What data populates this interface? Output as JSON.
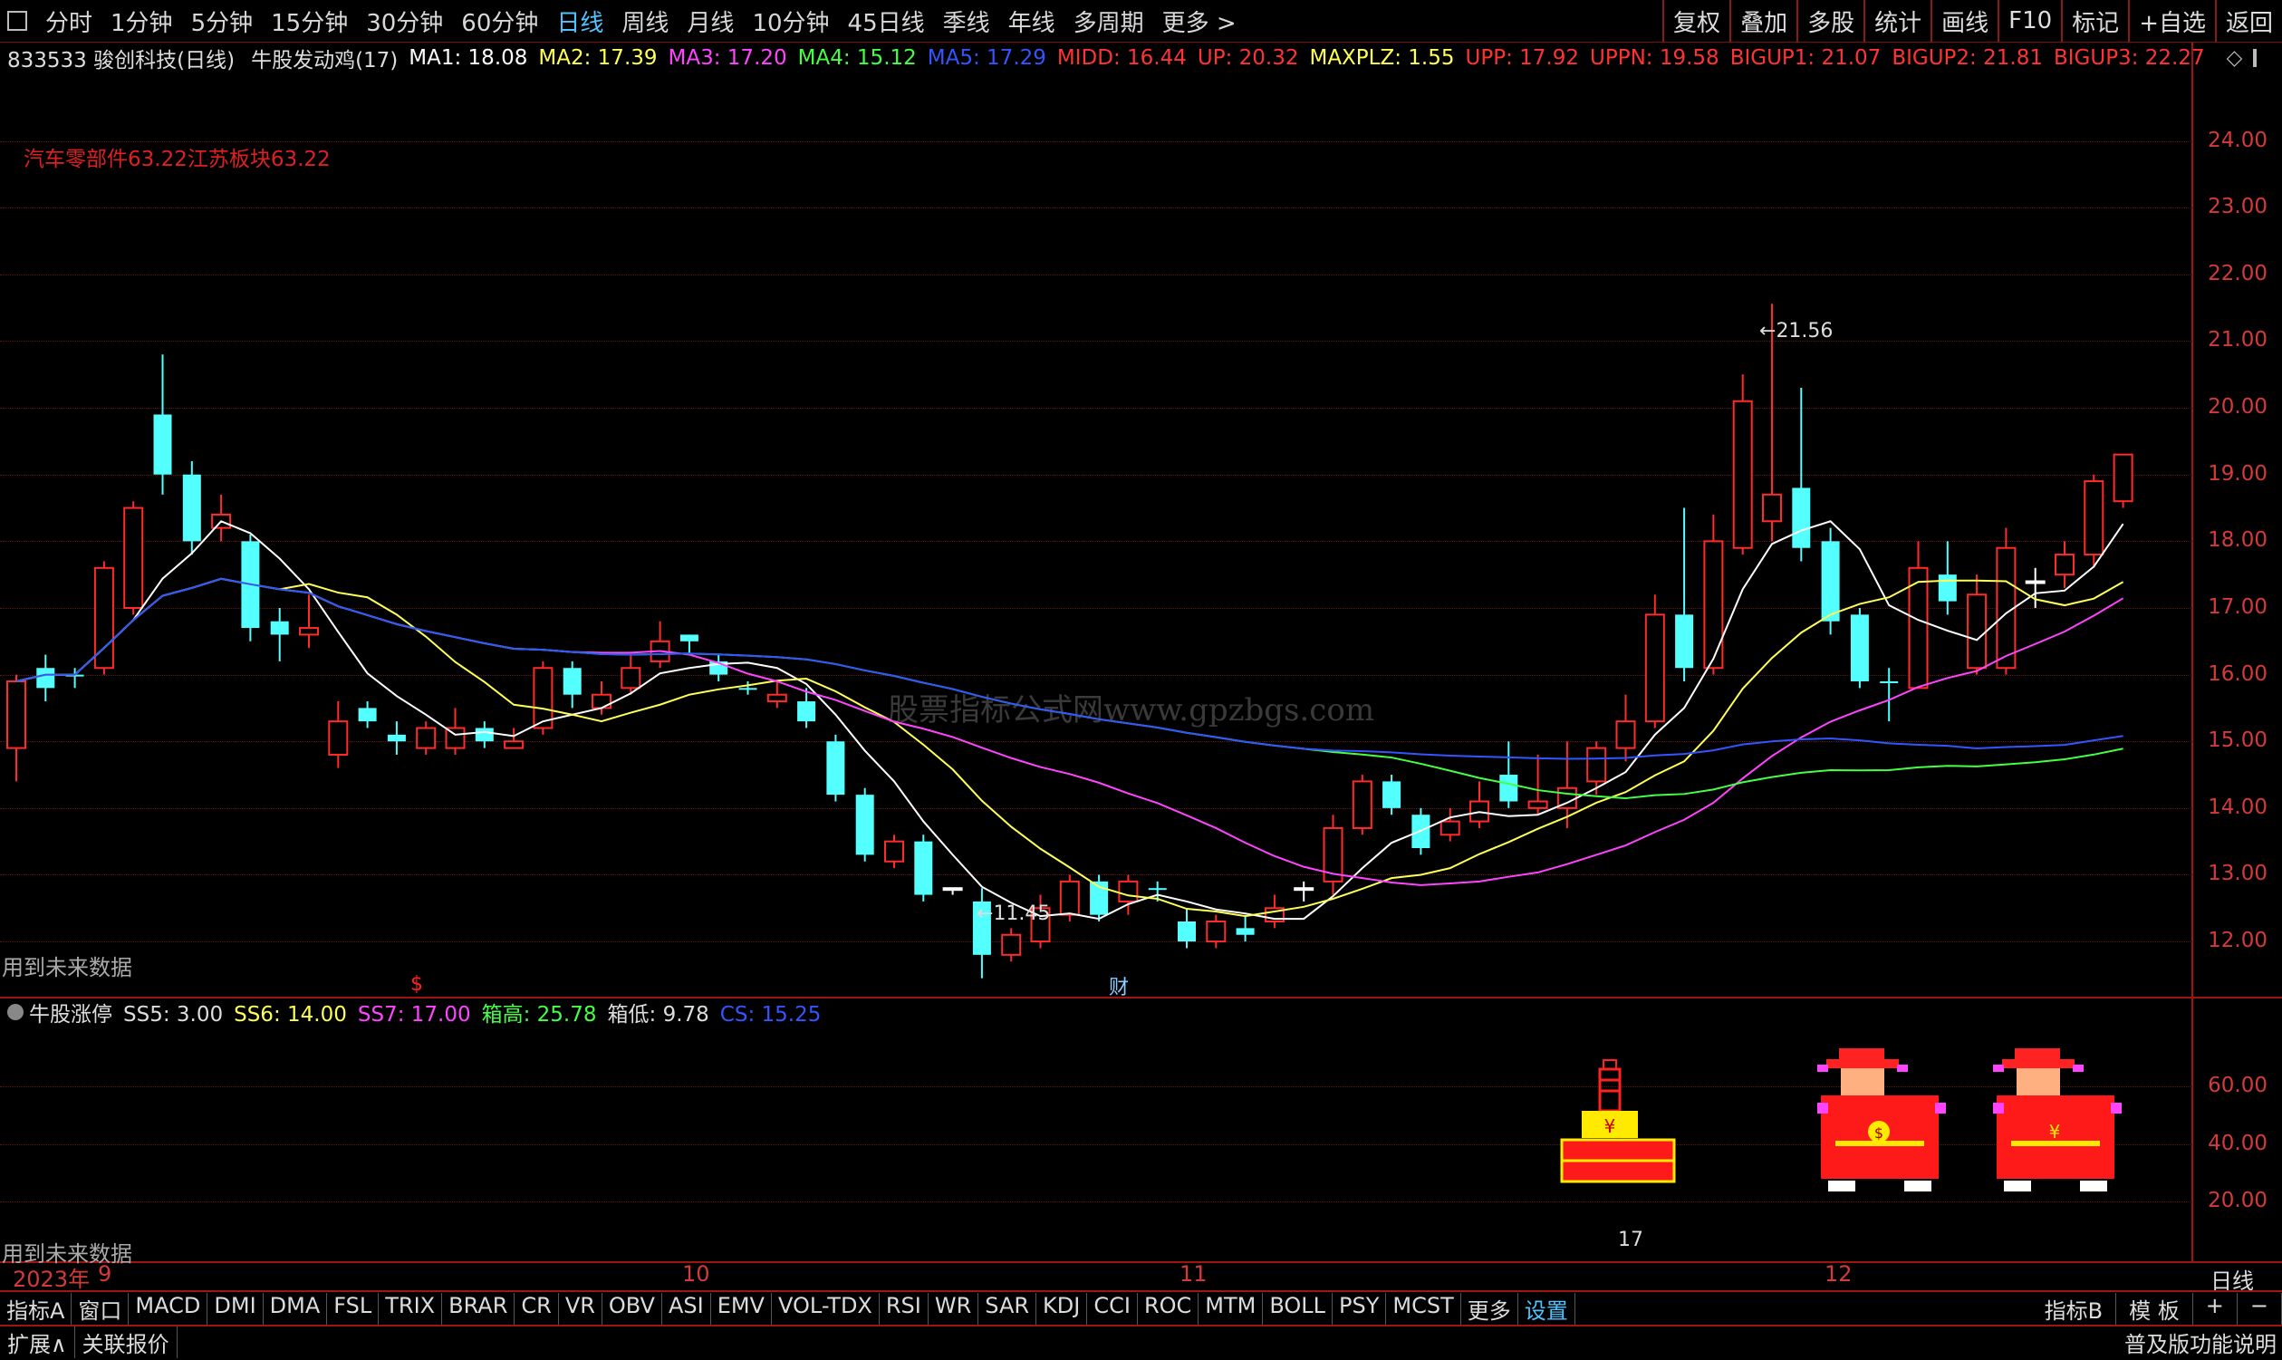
{
  "topbar": {
    "periods": [
      "分时",
      "1分钟",
      "5分钟",
      "15分钟",
      "30分钟",
      "60分钟",
      "日线",
      "周线",
      "月线",
      "10分钟",
      "45日线",
      "季线",
      "年线",
      "多周期",
      "更多 >"
    ],
    "active_period": "日线",
    "right_buttons": [
      "复权",
      "叠加",
      "多股",
      "统计",
      "画线",
      "F10",
      "标记",
      "+自选",
      "返回"
    ]
  },
  "infobar": {
    "stock": "833533 骏创科技(日线)",
    "formula": "牛股发动鸡(17)",
    "params": [
      {
        "text": "MA1: 18.08",
        "color": "#ffffff"
      },
      {
        "text": "MA2: 17.39",
        "color": "#ffff55"
      },
      {
        "text": "MA3: 17.20",
        "color": "#ff44ff"
      },
      {
        "text": "MA4: 15.12",
        "color": "#44ff44"
      },
      {
        "text": "MA5: 17.29",
        "color": "#3355ff"
      },
      {
        "text": "MIDD: 16.44",
        "color": "#ff3333"
      },
      {
        "text": "UP: 20.32",
        "color": "#ff3333"
      },
      {
        "text": "MAXPLZ: 1.55",
        "color": "#ffff55"
      },
      {
        "text": "UPP: 17.92",
        "color": "#ff3333"
      },
      {
        "text": "UPPN: 19.58",
        "color": "#ff3333"
      },
      {
        "text": "BIGUP1: 21.07",
        "color": "#ff3333"
      },
      {
        "text": "BIGUP2: 21.81",
        "color": "#ff3333"
      },
      {
        "text": "BIGUP3: 22.27",
        "color": "#ff3333"
      }
    ]
  },
  "main_chart": {
    "sector_label": "汽车零部件63.22江苏板块63.22",
    "future_data_note": "用到未来数据",
    "high_label": "21.56",
    "low_label": "11.45",
    "yticks": [
      "24.00",
      "23.00",
      "22.00",
      "21.00",
      "20.00",
      "19.00",
      "18.00",
      "17.00",
      "16.00",
      "15.00",
      "14.00",
      "13.00",
      "12.00"
    ],
    "watermark": "股票指标公式网www.gpzbgs.com",
    "marker_s": "$",
    "marker_cai": "财"
  },
  "indicator_panel": {
    "title": "牛股涨停",
    "params": [
      {
        "text": "SS5: 3.00",
        "color": "#dddddd"
      },
      {
        "text": "SS6: 14.00",
        "color": "#ffff55"
      },
      {
        "text": "SS7: 17.00",
        "color": "#ff44ff"
      },
      {
        "text": "箱高: 25.78",
        "color": "#44ff44"
      },
      {
        "text": "箱低: 9.78",
        "color": "#dddddd"
      },
      {
        "text": "CS: 15.25",
        "color": "#3355ff"
      }
    ],
    "yticks": [
      "60.00",
      "40.00",
      "20.00"
    ],
    "value_label": "17",
    "future_data_note": "用到未来数据"
  },
  "date_axis": {
    "labels": [
      "2023年",
      "9",
      "10",
      "11",
      "12"
    ],
    "period_label": "日线"
  },
  "tabs": [
    "指标A",
    "窗口",
    "MACD",
    "DMI",
    "DMA",
    "FSL",
    "TRIX",
    "BRAR",
    "CR",
    "VR",
    "OBV",
    "ASI",
    "EMV",
    "VOL-TDX",
    "RSI",
    "WR",
    "SAR",
    "KDJ",
    "CCI",
    "ROC",
    "MTM",
    "BOLL",
    "PSY",
    "MCST",
    "更多",
    "设置"
  ],
  "active_tab": "设置",
  "tab_right": [
    "指标B",
    "模 板",
    "+",
    "−"
  ],
  "status": {
    "expand": "扩展∧",
    "related": "关联报价",
    "right": "普及版功能说明"
  },
  "chart_data": {
    "type": "candlestick",
    "ylim": [
      11.2,
      25.0
    ],
    "candles": [
      [
        14.9,
        15.9,
        14.4,
        16.0,
        "down"
      ],
      [
        15.8,
        16.1,
        15.6,
        16.3,
        "up"
      ],
      [
        16.0,
        16.0,
        15.8,
        16.1,
        "up"
      ],
      [
        16.1,
        17.6,
        16.0,
        17.7,
        "down"
      ],
      [
        17.0,
        18.5,
        16.9,
        18.6,
        "down"
      ],
      [
        19.9,
        19.0,
        18.7,
        20.8,
        "up"
      ],
      [
        19.0,
        18.0,
        17.8,
        19.2,
        "up"
      ],
      [
        18.2,
        18.4,
        18.0,
        18.7,
        "down"
      ],
      [
        18.0,
        16.7,
        16.5,
        18.1,
        "up"
      ],
      [
        16.8,
        16.6,
        16.2,
        17.0,
        "up"
      ],
      [
        16.6,
        16.7,
        16.4,
        17.2,
        "down"
      ],
      [
        15.3,
        14.8,
        14.6,
        15.6,
        "down"
      ],
      [
        15.5,
        15.3,
        15.2,
        15.6,
        "up"
      ],
      [
        15.1,
        15.0,
        14.8,
        15.3,
        "up"
      ],
      [
        14.9,
        15.2,
        14.8,
        15.3,
        "down"
      ],
      [
        14.9,
        15.2,
        14.8,
        15.5,
        "down"
      ],
      [
        15.2,
        15.0,
        14.9,
        15.3,
        "up"
      ],
      [
        14.9,
        15.0,
        14.9,
        15.2,
        "down"
      ],
      [
        15.2,
        16.1,
        15.1,
        16.2,
        "down"
      ],
      [
        16.1,
        15.7,
        15.5,
        16.2,
        "up"
      ],
      [
        15.5,
        15.7,
        15.4,
        15.9,
        "down"
      ],
      [
        15.8,
        16.1,
        15.7,
        16.3,
        "down"
      ],
      [
        16.2,
        16.5,
        16.1,
        16.8,
        "down"
      ],
      [
        16.6,
        16.5,
        16.3,
        16.6,
        "up"
      ],
      [
        16.2,
        16.0,
        15.9,
        16.3,
        "up"
      ],
      [
        15.8,
        15.8,
        15.7,
        15.9,
        "up"
      ],
      [
        15.6,
        15.7,
        15.5,
        15.9,
        "down"
      ],
      [
        15.6,
        15.3,
        15.2,
        15.8,
        "up"
      ],
      [
        15.0,
        14.2,
        14.1,
        15.1,
        "up"
      ],
      [
        14.2,
        13.3,
        13.2,
        14.3,
        "up"
      ],
      [
        13.2,
        13.5,
        13.1,
        13.6,
        "down"
      ],
      [
        13.5,
        12.7,
        12.6,
        13.6,
        "up"
      ],
      [
        12.8,
        12.8,
        12.7,
        12.8,
        "flat"
      ],
      [
        12.6,
        11.8,
        11.45,
        12.8,
        "up"
      ],
      [
        11.8,
        12.1,
        11.7,
        12.2,
        "down"
      ],
      [
        12.0,
        12.5,
        11.9,
        12.7,
        "down"
      ],
      [
        12.4,
        12.9,
        12.3,
        13.0,
        "down"
      ],
      [
        12.9,
        12.4,
        12.3,
        13.0,
        "up"
      ],
      [
        12.6,
        12.9,
        12.4,
        13.0,
        "down"
      ],
      [
        12.8,
        12.8,
        12.6,
        12.9,
        "up"
      ],
      [
        12.3,
        12.0,
        11.9,
        12.5,
        "up"
      ],
      [
        12.0,
        12.3,
        11.9,
        12.4,
        "down"
      ],
      [
        12.2,
        12.1,
        12.0,
        12.4,
        "up"
      ],
      [
        12.3,
        12.5,
        12.2,
        12.7,
        "down"
      ],
      [
        12.8,
        12.8,
        12.6,
        12.9,
        "flat"
      ],
      [
        12.9,
        13.7,
        12.7,
        13.9,
        "down"
      ],
      [
        13.7,
        14.4,
        13.6,
        14.5,
        "down"
      ],
      [
        14.4,
        14.0,
        13.9,
        14.5,
        "up"
      ],
      [
        13.9,
        13.4,
        13.3,
        14.0,
        "up"
      ],
      [
        13.6,
        13.8,
        13.5,
        14.0,
        "down"
      ],
      [
        13.8,
        14.1,
        13.7,
        14.4,
        "down"
      ],
      [
        14.5,
        14.1,
        14.0,
        15.0,
        "up"
      ],
      [
        14.0,
        14.1,
        13.9,
        14.8,
        "down"
      ],
      [
        14.0,
        14.3,
        13.7,
        15.0,
        "down"
      ],
      [
        14.4,
        14.9,
        14.2,
        15.0,
        "down"
      ],
      [
        14.9,
        15.3,
        14.7,
        15.7,
        "down"
      ],
      [
        15.3,
        16.9,
        15.2,
        17.2,
        "down"
      ],
      [
        16.9,
        16.1,
        15.9,
        18.5,
        "up"
      ],
      [
        16.1,
        18.0,
        16.0,
        18.4,
        "down"
      ],
      [
        17.9,
        20.1,
        17.8,
        20.5,
        "down"
      ],
      [
        18.3,
        18.7,
        18.0,
        21.56,
        "down"
      ],
      [
        18.8,
        17.9,
        17.7,
        20.3,
        "up"
      ],
      [
        18.0,
        16.8,
        16.6,
        18.2,
        "up"
      ],
      [
        16.9,
        15.9,
        15.8,
        17.0,
        "up"
      ],
      [
        15.9,
        15.9,
        15.3,
        16.1,
        "up"
      ],
      [
        15.8,
        17.6,
        15.8,
        18.0,
        "down"
      ],
      [
        17.5,
        17.1,
        16.9,
        18.0,
        "up"
      ],
      [
        17.2,
        16.1,
        16.0,
        17.5,
        "down"
      ],
      [
        16.1,
        17.9,
        16.0,
        18.2,
        "down"
      ],
      [
        17.4,
        17.4,
        17.0,
        17.6,
        "flat"
      ],
      [
        17.5,
        17.8,
        17.3,
        18.0,
        "down"
      ],
      [
        17.8,
        18.9,
        17.6,
        19.0,
        "down"
      ],
      [
        18.6,
        19.3,
        18.5,
        19.3,
        "down"
      ]
    ],
    "series": [
      {
        "name": "MA1",
        "color": "#ffffff"
      },
      {
        "name": "MA2",
        "color": "#ffff55"
      },
      {
        "name": "MA3",
        "color": "#ff44ff"
      },
      {
        "name": "MA4",
        "color": "#44ff44"
      },
      {
        "name": "MA5",
        "color": "#3355ff"
      }
    ]
  }
}
